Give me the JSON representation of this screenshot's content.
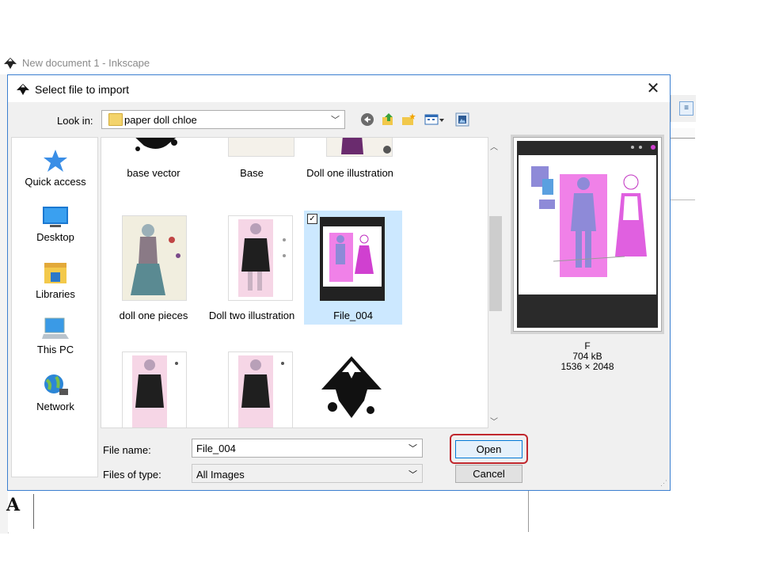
{
  "background_window": {
    "title": "New document 1 - Inkscape"
  },
  "dialog": {
    "title": "Select file to import",
    "look_in_label": "Look in:",
    "look_in_value": "paper doll chloe",
    "places": [
      {
        "label": "Quick access",
        "icon": "star-icon"
      },
      {
        "label": "Desktop",
        "icon": "desktop-icon"
      },
      {
        "label": "Libraries",
        "icon": "libraries-icon"
      },
      {
        "label": "This PC",
        "icon": "computer-icon"
      },
      {
        "label": "Network",
        "icon": "network-icon"
      }
    ],
    "files": [
      {
        "name": "base vector",
        "selected": false
      },
      {
        "name": "Base",
        "selected": false
      },
      {
        "name": "Doll one illustration",
        "selected": false
      },
      {
        "name": "doll one pieces",
        "selected": false
      },
      {
        "name": "Doll two illustration",
        "selected": false
      },
      {
        "name": "File_004",
        "selected": true
      },
      {
        "name": "",
        "selected": false
      },
      {
        "name": "",
        "selected": false
      },
      {
        "name": "",
        "selected": false
      }
    ],
    "preview": {
      "name": "F",
      "size": "704 kB",
      "dimensions": "1536 × 2048"
    },
    "file_name_label": "File name:",
    "file_name_value": "File_004",
    "file_type_label": "Files of type:",
    "file_type_value": "All Images",
    "open_label": "Open",
    "cancel_label": "Cancel",
    "close_glyph": "✕"
  },
  "colors": {
    "accent": "#0078d7",
    "highlight": "#c0272d",
    "selection": "#cce8ff",
    "pink": "#f081e8"
  }
}
